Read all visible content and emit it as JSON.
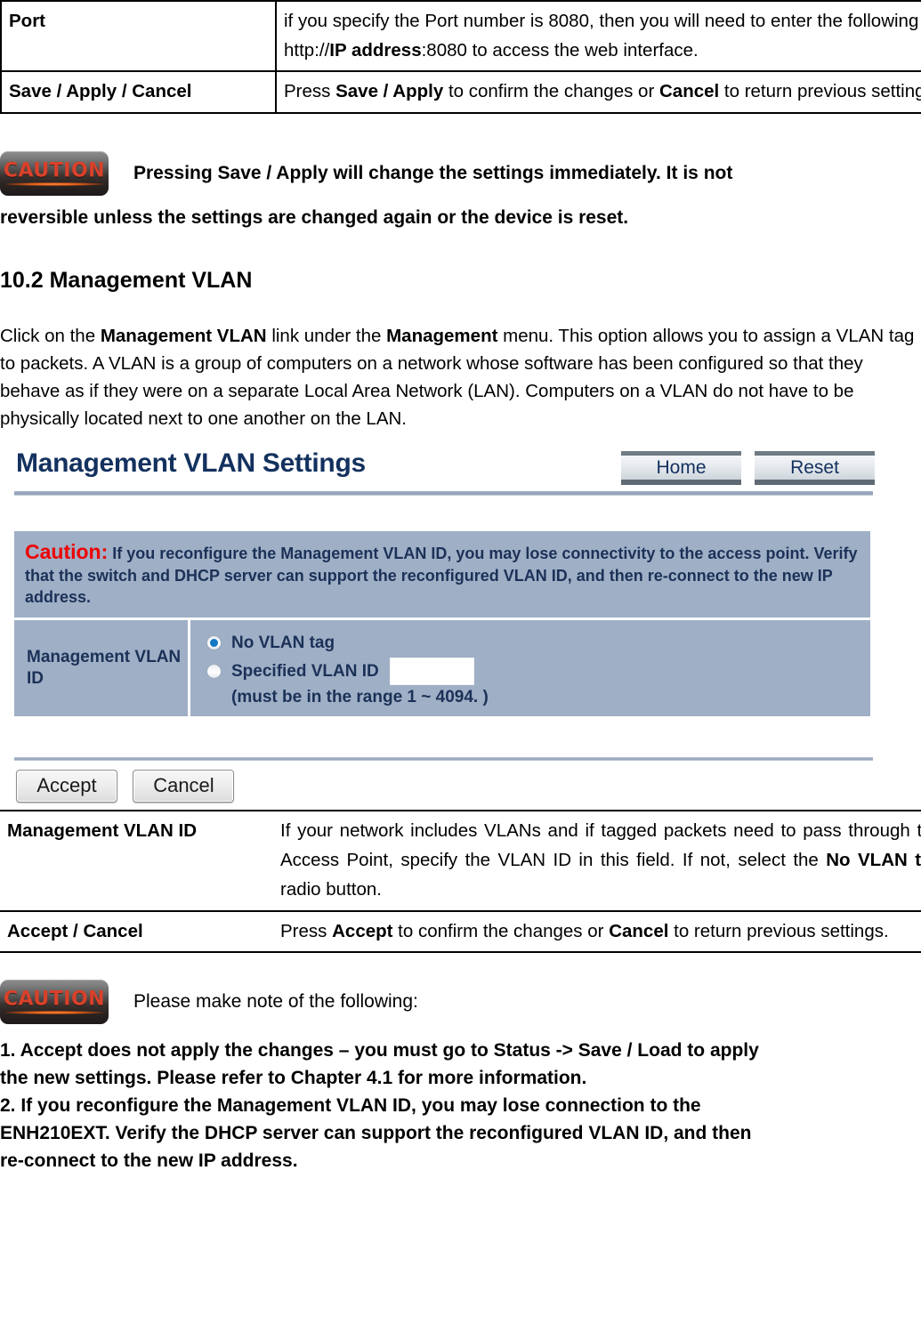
{
  "top_table": {
    "rows": [
      {
        "label": "Port",
        "desc_parts": [
          {
            "text": "if you specify the Port number is 8080, then you will need to enter the following http://",
            "bold": false
          },
          {
            "text": "IP address",
            "bold": true
          },
          {
            "text": ":8080 to access the web interface.",
            "bold": false
          }
        ]
      },
      {
        "label": "Save / Apply / Cancel",
        "desc_parts": [
          {
            "text": "Press ",
            "bold": false
          },
          {
            "text": "Save / Apply",
            "bold": true
          },
          {
            "text": " to confirm the changes or ",
            "bold": false
          },
          {
            "text": "Cancel",
            "bold": true
          },
          {
            "text": " to return previous settings.",
            "bold": false
          }
        ]
      }
    ]
  },
  "caution_top": {
    "icon_label": "CAUTION",
    "line1": "Pressing Save / Apply will change the settings immediately. It is not",
    "line2": "reversible unless the settings are changed again or the device is reset."
  },
  "section": {
    "heading": "10.2 Management VLAN",
    "paragraph_parts": [
      {
        "text": "Click on the ",
        "bold": false
      },
      {
        "text": "Management VLAN",
        "bold": true
      },
      {
        "text": " link under the ",
        "bold": false
      },
      {
        "text": "Management",
        "bold": true
      },
      {
        "text": " menu. This option allows you to assign a VLAN tag to packets. A VLAN is a group of computers on a network whose software has been configured so that they behave as if they were on a separate Local Area Network (LAN). Computers on a VLAN do not have to be physically located next to one another on the LAN.",
        "bold": false
      }
    ]
  },
  "ui_screenshot": {
    "title": "Management VLAN Settings",
    "home_button": "Home",
    "reset_button": "Reset",
    "caution": {
      "prefix": "Caution:",
      "body": "If you reconfigure the Management VLAN ID, you may lose connectivity to the access point. Verify that the switch and DHCP server can support the reconfigured VLAN ID, and then re-connect to the new IP address."
    },
    "vlan_row": {
      "label": "Management VLAN ID",
      "option_no_tag": "No VLAN tag",
      "option_specified": "Specified VLAN ID",
      "specified_value": "",
      "range_note": "(must be in the range 1 ~ 4094. )"
    },
    "accept_button": "Accept",
    "cancel_button": "Cancel"
  },
  "bottom_table": {
    "rows": [
      {
        "label": "Management VLAN ID",
        "desc_parts": [
          {
            "text": "If your network includes VLANs and if tagged packets need to pass through the Access Point, specify the VLAN ID in this field. If not, select the ",
            "bold": false
          },
          {
            "text": "No VLAN tag",
            "bold": true
          },
          {
            "text": " radio button.",
            "bold": false
          }
        ]
      },
      {
        "label": "Accept / Cancel",
        "desc_parts": [
          {
            "text": "Press ",
            "bold": false
          },
          {
            "text": "Accept",
            "bold": true
          },
          {
            "text": " to confirm the changes or ",
            "bold": false
          },
          {
            "text": "Cancel",
            "bold": true
          },
          {
            "text": " to return previous settings.",
            "bold": false
          }
        ]
      }
    ]
  },
  "caution_bottom": {
    "icon_label": "CAUTION",
    "intro": "Please make note of the following:",
    "note1_line1": "1. Accept does not apply the changes – you must go to Status -> Save / Load to apply",
    "note1_line2": "the new settings. Please refer to Chapter 4.1 for more information.",
    "note2_line1": "2. If you reconfigure the Management VLAN ID, you may lose connection to the",
    "note2_line2": "ENH210EXT. Verify the DHCP server can support the reconfigured VLAN ID, and then",
    "note2_line3": "re-connect to the new IP address."
  },
  "colors": {
    "ui_panel_bg": "#9fafc6",
    "ui_title": "#13315e",
    "caution_red": "#ee0000",
    "radio_accent": "#1277c4"
  }
}
